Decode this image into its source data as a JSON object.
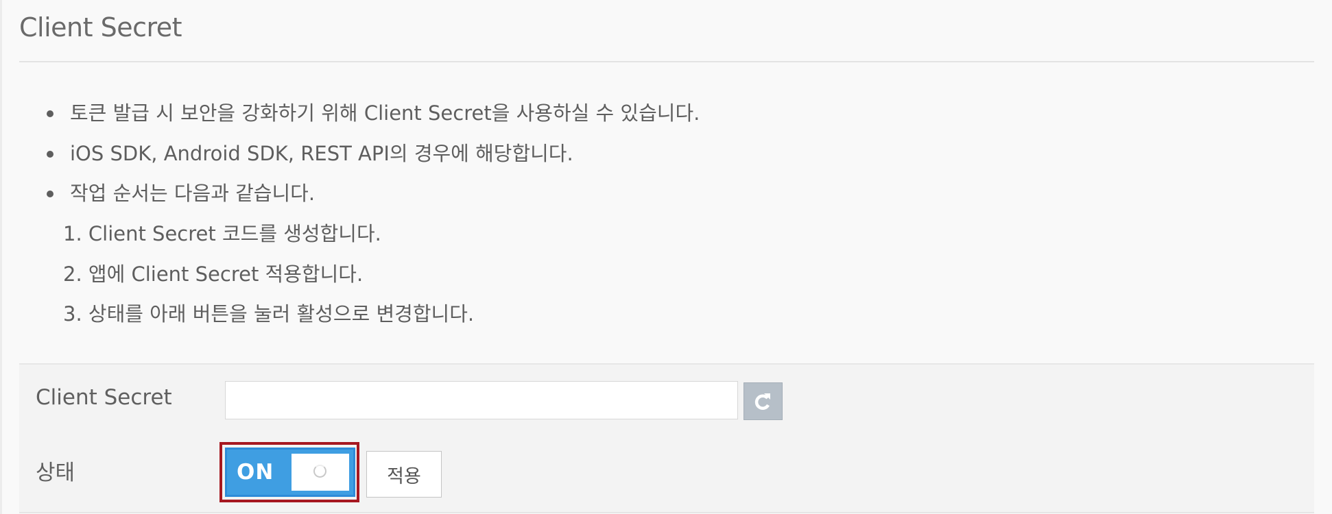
{
  "section": {
    "title": "Client Secret"
  },
  "info": {
    "bullets": [
      "토큰 발급 시 보안을 강화하기 위해 Client Secret을 사용하실 수 있습니다.",
      "iOS SDK, Android SDK, REST API의 경우에 해당합니다.",
      "작업 순서는 다음과 같습니다."
    ],
    "steps": [
      "1. Client Secret 코드를 생성합니다.",
      "2. 앱에 Client Secret 적용합니다.",
      "3. 상태를 아래 버튼을 눌러 활성으로 변경합니다."
    ]
  },
  "form": {
    "secret_label": "Client Secret",
    "secret_value": "",
    "refresh_icon": "refresh-icon",
    "status_label": "상태",
    "toggle_state": "ON",
    "apply_label": "적용"
  },
  "colors": {
    "toggle_on": "#3f9ee2",
    "highlight": "#a61720",
    "refresh_button": "#b6bfc8"
  }
}
